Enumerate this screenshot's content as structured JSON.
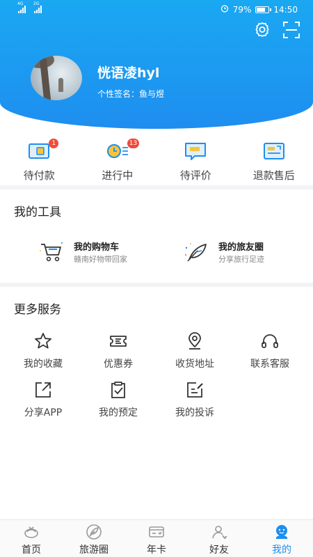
{
  "status_bar": {
    "signal1_label": "4G",
    "signal2_label": "2G",
    "battery_text": "79%",
    "battery_level": 0.79,
    "time": "14:50"
  },
  "header": {
    "username": "恍语凌hyl",
    "signature": "个性签名：鱼与煜"
  },
  "orders": [
    {
      "label": "待付款",
      "badge": "1",
      "icon": "wallet-icon"
    },
    {
      "label": "进行中",
      "badge": "13",
      "icon": "clock-list-icon"
    },
    {
      "label": "待评价",
      "badge": "",
      "icon": "comment-icon"
    },
    {
      "label": "退款售后",
      "badge": "",
      "icon": "refund-icon"
    }
  ],
  "tools": {
    "title": "我的工具",
    "items": [
      {
        "title": "我的购物车",
        "subtitle": "赣南好物带回家",
        "icon": "shopping-cart-icon"
      },
      {
        "title": "我的旅友圈",
        "subtitle": "分享旅行足迹",
        "icon": "feather-icon"
      }
    ]
  },
  "services": {
    "title": "更多服务",
    "items": [
      {
        "label": "我的收藏",
        "icon": "star-icon"
      },
      {
        "label": "优惠券",
        "icon": "ticket-icon"
      },
      {
        "label": "收货地址",
        "icon": "location-icon"
      },
      {
        "label": "联系客服",
        "icon": "headset-icon"
      },
      {
        "label": "分享APP",
        "icon": "share-icon"
      },
      {
        "label": "我的预定",
        "icon": "clipboard-check-icon"
      },
      {
        "label": "我的投诉",
        "icon": "edit-icon"
      }
    ]
  },
  "tabbar": [
    {
      "label": "首页",
      "icon": "home-icon",
      "active": false
    },
    {
      "label": "旅游圈",
      "icon": "leaf-icon",
      "active": false
    },
    {
      "label": "年卡",
      "icon": "card-icon",
      "active": false
    },
    {
      "label": "好友",
      "icon": "friends-icon",
      "active": false
    },
    {
      "label": "我的",
      "icon": "profile-icon",
      "active": true
    }
  ],
  "colors": {
    "accent": "#1e8ef0",
    "badge": "#f04b3a"
  }
}
